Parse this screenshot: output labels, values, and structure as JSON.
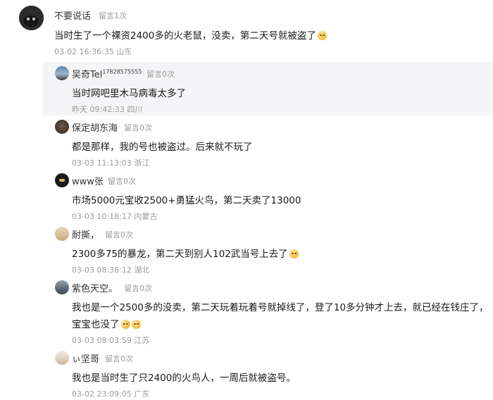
{
  "main_comment": {
    "nickname": "不要说话",
    "message_count": "留言1次",
    "text": "当时生了一个裸资2400多的火老鼠，没卖，第二天号就被盗了",
    "emoji": "face-emoji",
    "meta": "03-02 16:36:35 山东"
  },
  "replies": [
    {
      "nickname": "吴奇Tel",
      "phone": "17828575555",
      "message_count": "留言0次",
      "text": "当时网吧里木马病毒太多了",
      "meta": "昨天 09:42:33 四川",
      "highlighted": true
    },
    {
      "nickname": "保定胡东海",
      "message_count": "留言0次",
      "text": "都是那样，我的号也被盗过。后来就不玩了",
      "meta": "03-03 11:13:03 浙江"
    },
    {
      "nickname": "www张",
      "message_count": "留言0次",
      "text": "市场5000元宝收2500+勇猛火鸟，第二天卖了13000",
      "meta": "03-03 10:18:17 内蒙古"
    },
    {
      "nickname": "耐撕，",
      "message_count": "留言0次",
      "text": "2300多75的暴龙，第二天到别人102武当号上去了",
      "emoji": "face-emoji",
      "meta": "03-03 08:38:12 湖北"
    },
    {
      "nickname": "紫色天空。",
      "message_count": "留言0次",
      "text": "我也是一个2500多的没卖，第二天玩着玩着号就掉线了，登了10多分钟才上去，就已经在钱庄了，",
      "text2": "宝宝也没了",
      "emoji": "face-emoji",
      "meta": "03-03 08:03:59 江苏"
    },
    {
      "nickname": "ぃ坚哥",
      "message_count": "留言0次",
      "text": "我也是当时生了只2400的火鸟人，一周后就被盗号。",
      "meta": "03-02 23:09:05 广东"
    }
  ]
}
